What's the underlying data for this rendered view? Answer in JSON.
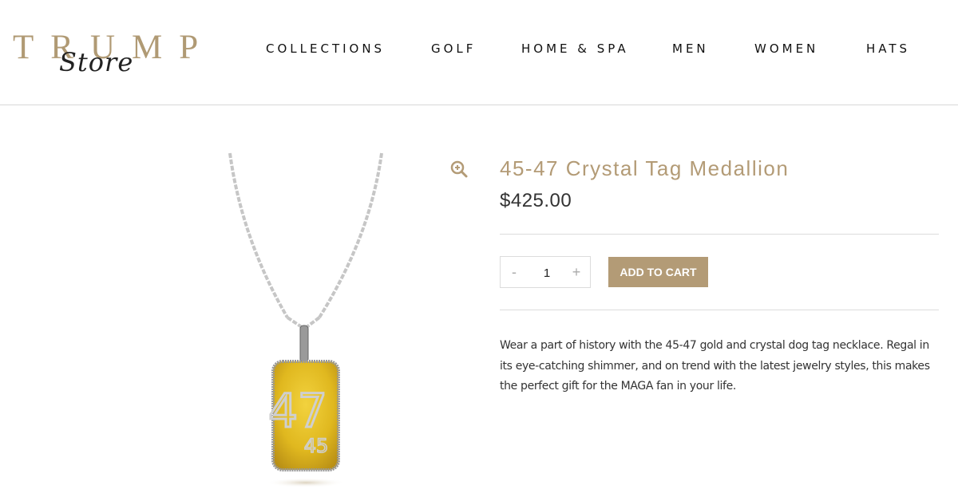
{
  "header": {
    "logo": {
      "main": "TRUMP",
      "script": "Store"
    },
    "nav": [
      {
        "id": "collections",
        "label": "COLLECTIONS"
      },
      {
        "id": "golf",
        "label": "GOLF"
      },
      {
        "id": "home-spa",
        "label": "HOME & SPA"
      },
      {
        "id": "men",
        "label": "MEN"
      },
      {
        "id": "women",
        "label": "WOMEN"
      },
      {
        "id": "hats",
        "label": "HATS"
      }
    ]
  },
  "product": {
    "title": "45-47 Crystal Tag Medallion",
    "price": "$425.00",
    "image": {
      "digits_top": "47",
      "digits_bottom": "45"
    },
    "quantity": {
      "minus": "-",
      "value": "1",
      "plus": "+"
    },
    "add_to_cart_label": "ADD TO CART",
    "description": "Wear a part of history with the 45-47 gold and crystal dog tag necklace. Regal in its eye-catching shimmer, and on trend with the latest jewelry styles, this makes the perfect gift for the MAGA fan in your life.",
    "zoom_icon": "zoom-in-icon"
  },
  "colors": {
    "brand_gold": "#b39b76",
    "text_dark": "#333333",
    "button_text": "#ffffff",
    "divider": "#dcdcdc"
  }
}
